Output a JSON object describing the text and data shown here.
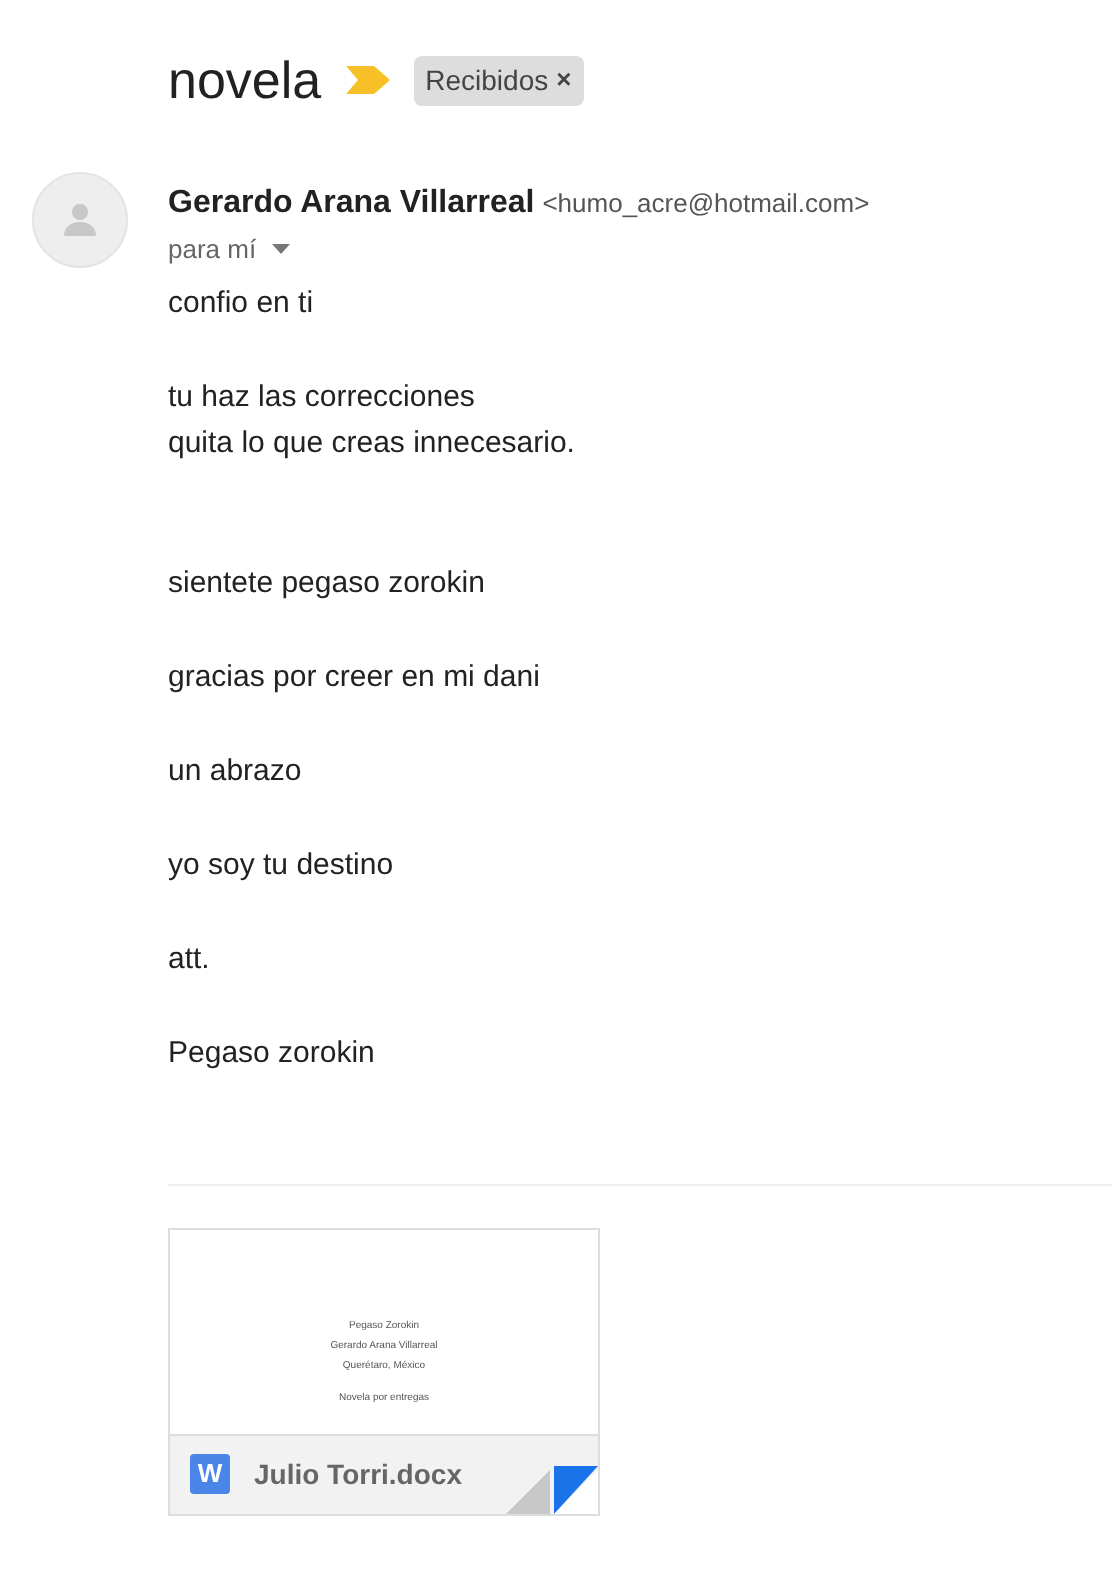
{
  "subject": {
    "title": "novela",
    "important": true,
    "labels": [
      {
        "text": "Recibidos",
        "close": "×"
      }
    ]
  },
  "message": {
    "sender_name": "Gerardo Arana Villarreal",
    "sender_email": "<humo_acre@hotmail.com>",
    "recipient": "para mí",
    "paragraphs": [
      [
        "confio en ti"
      ],
      [
        "tu haz las correcciones",
        "quita lo que creas innecesario."
      ],
      [
        "sientete pegaso zorokin"
      ],
      [
        "gracias por creer en mi dani"
      ],
      [
        "un abrazo"
      ],
      [
        "yo soy tu destino"
      ],
      [
        "att."
      ],
      [
        "Pegaso zorokin"
      ]
    ]
  },
  "attachment": {
    "filename": "Julio Torri.docx",
    "type_letter": "W",
    "preview_lines": [
      "Pegaso Zorokin",
      "Gerardo Arana Villarreal",
      "Querétaro, México",
      "Novela por entregas"
    ]
  }
}
